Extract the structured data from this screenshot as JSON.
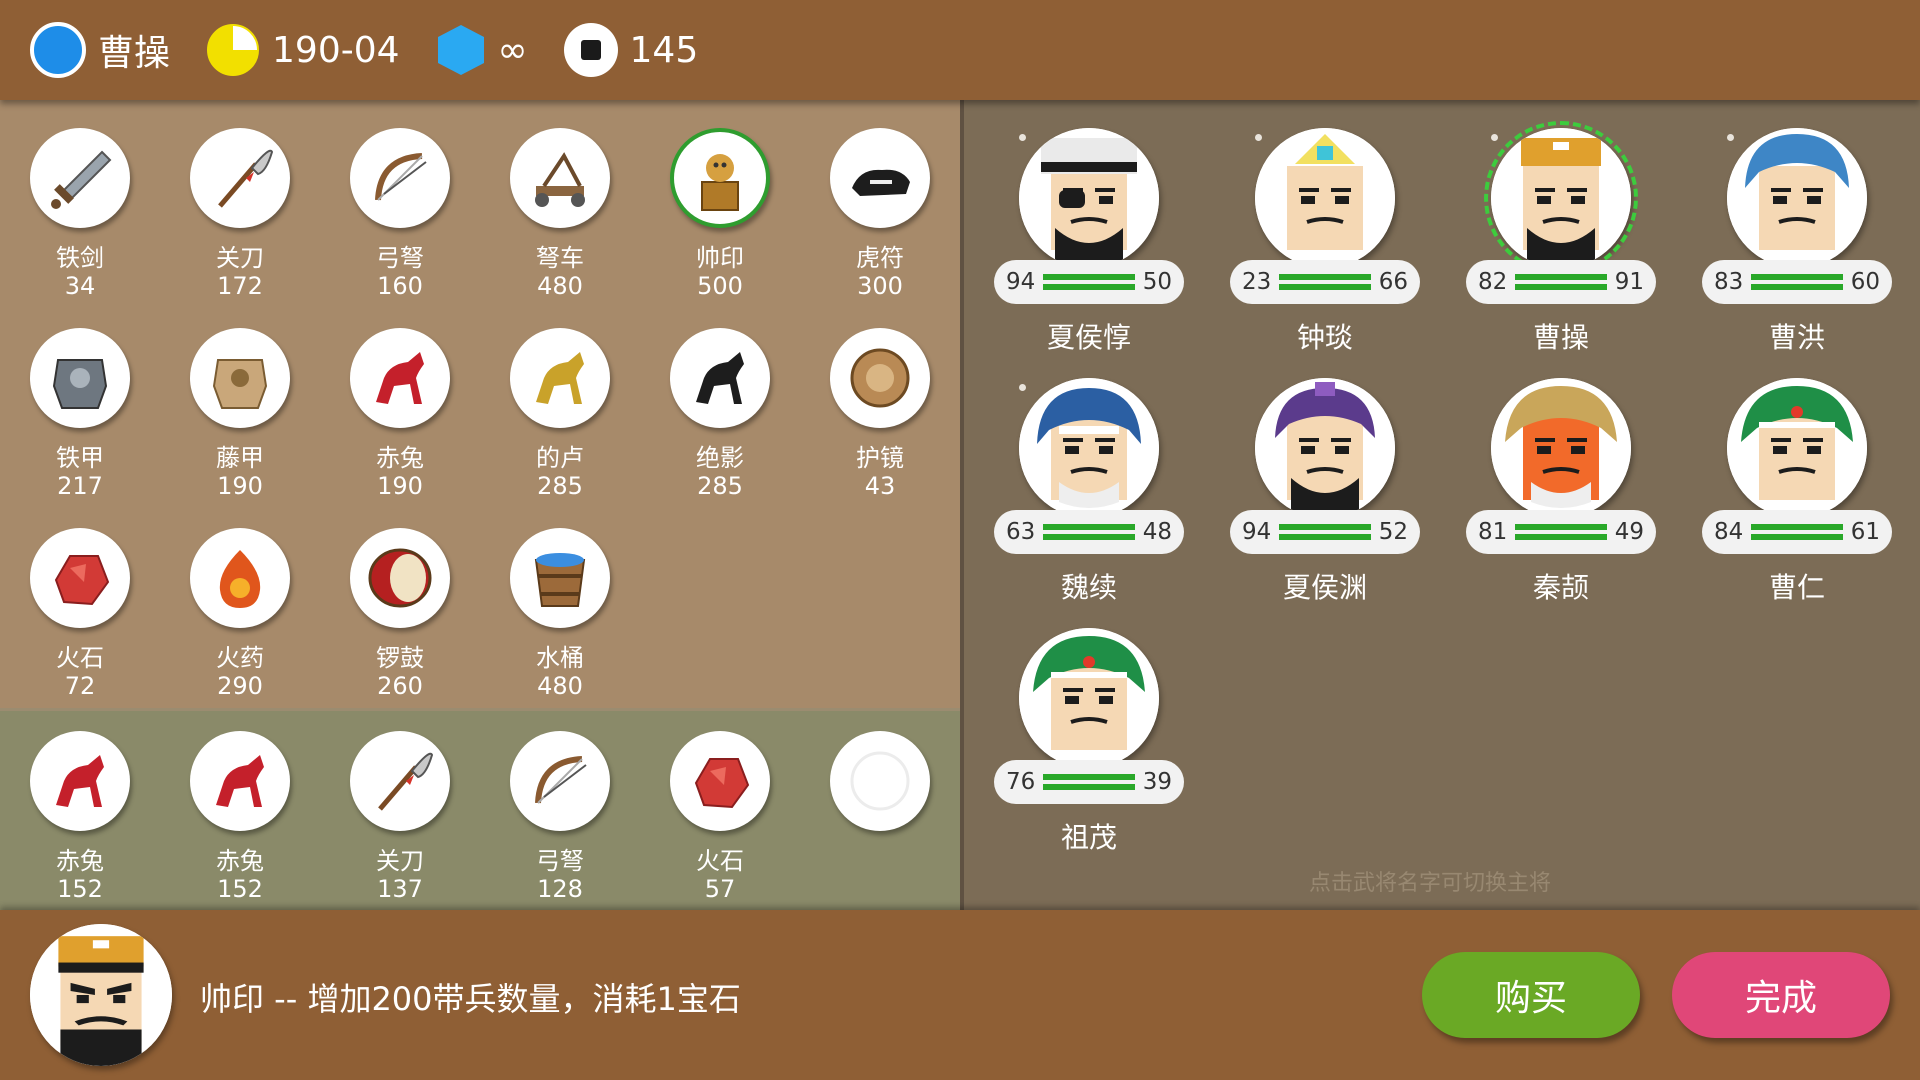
{
  "status": {
    "leader": "曹操",
    "date": "190-04",
    "gems": "∞",
    "troops": "145",
    "colors": {
      "faction": "#1e8de8",
      "clock": "#f2e000",
      "gem": "#2aa9f2"
    }
  },
  "shop": {
    "items": [
      {
        "name": "铁剑",
        "price": "34",
        "icon": "sword-icon"
      },
      {
        "name": "关刀",
        "price": "172",
        "icon": "guandao-icon"
      },
      {
        "name": "弓弩",
        "price": "160",
        "icon": "bow-icon"
      },
      {
        "name": "弩车",
        "price": "480",
        "icon": "ballista-icon"
      },
      {
        "name": "帅印",
        "price": "500",
        "icon": "seal-icon",
        "selected": true
      },
      {
        "name": "虎符",
        "price": "300",
        "icon": "tiger-tally-icon"
      },
      {
        "name": "铁甲",
        "price": "217",
        "icon": "iron-armor-icon"
      },
      {
        "name": "藤甲",
        "price": "190",
        "icon": "rattan-armor-icon"
      },
      {
        "name": "赤兔",
        "price": "190",
        "icon": "red-horse-icon"
      },
      {
        "name": "的卢",
        "price": "285",
        "icon": "yellow-horse-icon"
      },
      {
        "name": "绝影",
        "price": "285",
        "icon": "black-horse-icon"
      },
      {
        "name": "护镜",
        "price": "43",
        "icon": "mirror-icon"
      },
      {
        "name": "火石",
        "price": "72",
        "icon": "flint-icon"
      },
      {
        "name": "火药",
        "price": "290",
        "icon": "gunpowder-icon"
      },
      {
        "name": "锣鼓",
        "price": "260",
        "icon": "drum-icon"
      },
      {
        "name": "水桶",
        "price": "480",
        "icon": "bucket-icon"
      }
    ]
  },
  "inventory": {
    "items": [
      {
        "name": "赤兔",
        "price": "152",
        "icon": "red-horse-icon"
      },
      {
        "name": "赤兔",
        "price": "152",
        "icon": "red-horse-icon"
      },
      {
        "name": "关刀",
        "price": "137",
        "icon": "guandao-icon"
      },
      {
        "name": "弓弩",
        "price": "128",
        "icon": "bow-icon"
      },
      {
        "name": "火石",
        "price": "57",
        "icon": "flint-icon"
      },
      {
        "name": "",
        "price": "",
        "icon": "empty-slot-icon"
      }
    ]
  },
  "generals": {
    "list": [
      {
        "name": "夏侯惇",
        "left": "94",
        "right": "50",
        "face": "eyepatch",
        "dot": true
      },
      {
        "name": "钟琰",
        "left": "23",
        "right": "66",
        "face": "lady",
        "dot": true
      },
      {
        "name": "曹操",
        "left": "82",
        "right": "91",
        "face": "caocao",
        "dot": true,
        "active": true
      },
      {
        "name": "曹洪",
        "left": "83",
        "right": "60",
        "face": "blue",
        "dot": true
      },
      {
        "name": "魏续",
        "left": "63",
        "right": "48",
        "face": "helmet",
        "dot": true
      },
      {
        "name": "夏侯渊",
        "left": "94",
        "right": "52",
        "face": "purple"
      },
      {
        "name": "秦颉",
        "left": "81",
        "right": "49",
        "face": "orange"
      },
      {
        "name": "曹仁",
        "left": "84",
        "right": "61",
        "face": "green"
      },
      {
        "name": "祖茂",
        "left": "76",
        "right": "39",
        "face": "green2"
      }
    ],
    "hint": "点击武将名字可切换主将"
  },
  "bottom": {
    "description": "帅印 -- 增加200带兵数量，消耗1宝石",
    "buy_label": "购买",
    "done_label": "完成"
  }
}
